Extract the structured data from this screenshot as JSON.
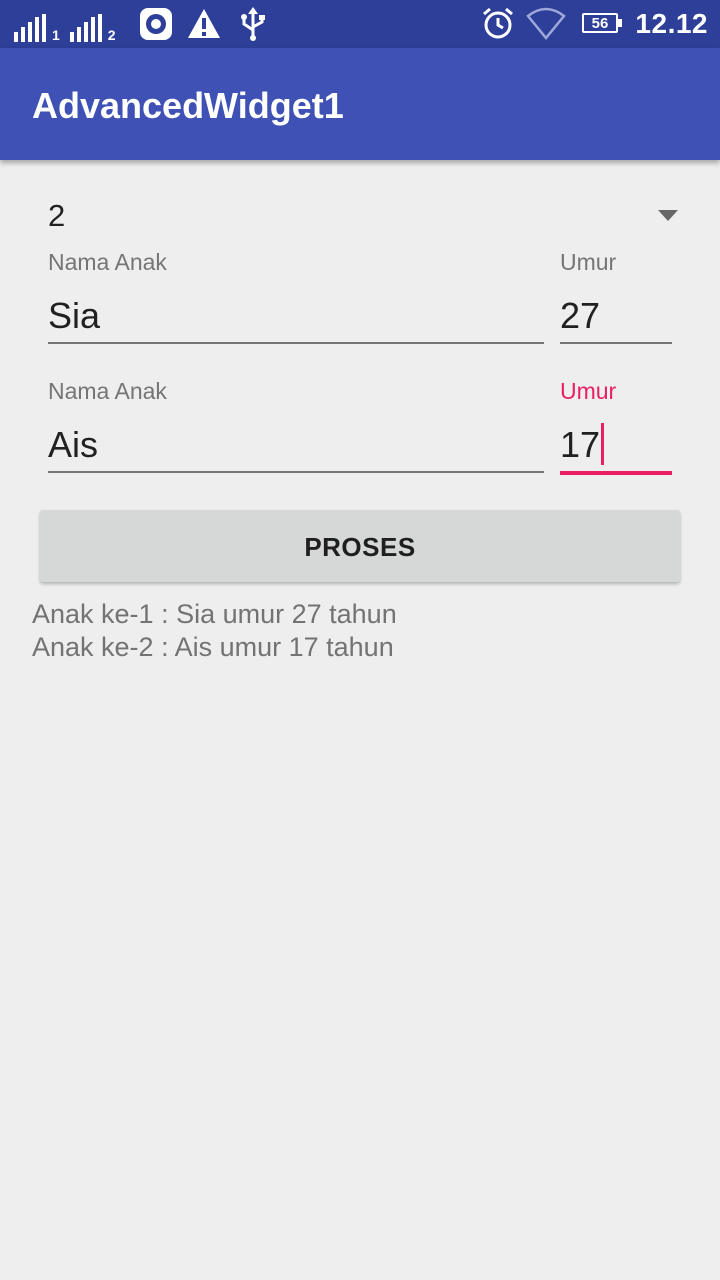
{
  "status_bar": {
    "sim1_label": "1",
    "sim2_label": "2",
    "battery_level": "56",
    "time": "12.12",
    "icons": [
      "signal-icon",
      "signal-icon",
      "sync-icon",
      "warning-icon",
      "usb-icon",
      "alarm-icon",
      "wifi-icon",
      "battery-icon"
    ]
  },
  "app_bar": {
    "title": "AdvancedWidget1"
  },
  "form": {
    "spinner_value": "2",
    "rows": [
      {
        "name_label": "Nama Anak",
        "name_value": "Sia",
        "age_label": "Umur",
        "age_value": "27",
        "age_focused": false
      },
      {
        "name_label": "Nama Anak",
        "name_value": "Ais",
        "age_label": "Umur",
        "age_value": "17",
        "age_focused": true
      }
    ],
    "button_label": "PROSES"
  },
  "result": {
    "lines": [
      "Anak ke-1 : Sia umur 27 tahun",
      "Anak ke-2 : Ais umur 17 tahun"
    ]
  },
  "colors": {
    "status_bar": "#2d3f98",
    "app_bar": "#3f51b5",
    "accent": "#e91e63",
    "background": "#eeeeee"
  }
}
